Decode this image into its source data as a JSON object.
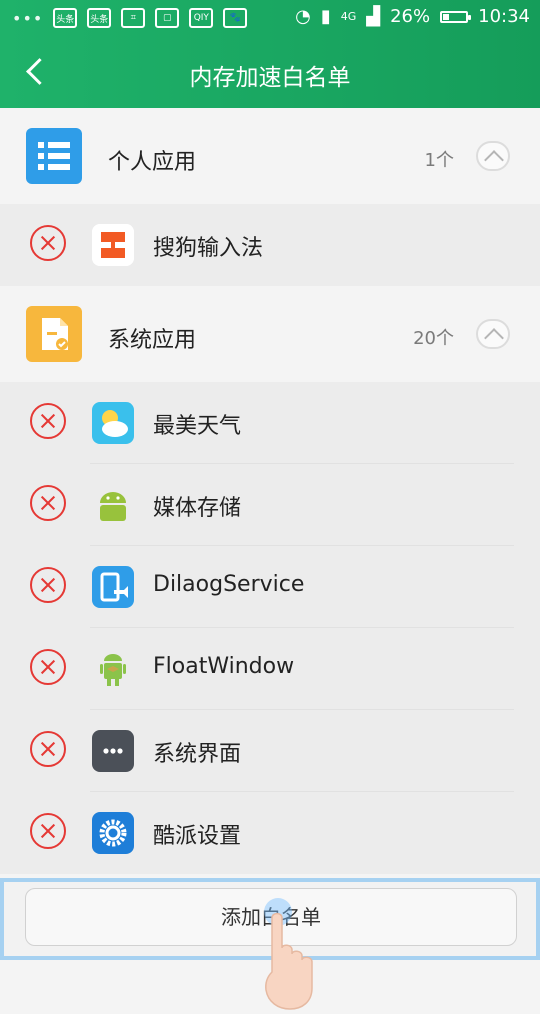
{
  "status_bar": {
    "left_badges": [
      "头条",
      "头条",
      "QIY"
    ],
    "battery_percent": "26%",
    "time": "10:34",
    "network": "4G"
  },
  "header": {
    "title": "内存加速白名单"
  },
  "sections": [
    {
      "title": "个人应用",
      "count": "1个",
      "apps": [
        "搜狗输入法"
      ]
    },
    {
      "title": "系统应用",
      "count": "20个",
      "apps": [
        "最美天气",
        "媒体存储",
        "DilaogService",
        "FloatWindow",
        "系统界面",
        "酷派设置"
      ]
    }
  ],
  "footer": {
    "button_label": "添加白名单"
  },
  "colors": {
    "header_green": "#19a861",
    "remove_red": "#e53935",
    "footer_highlight": "#a6d1f1"
  }
}
